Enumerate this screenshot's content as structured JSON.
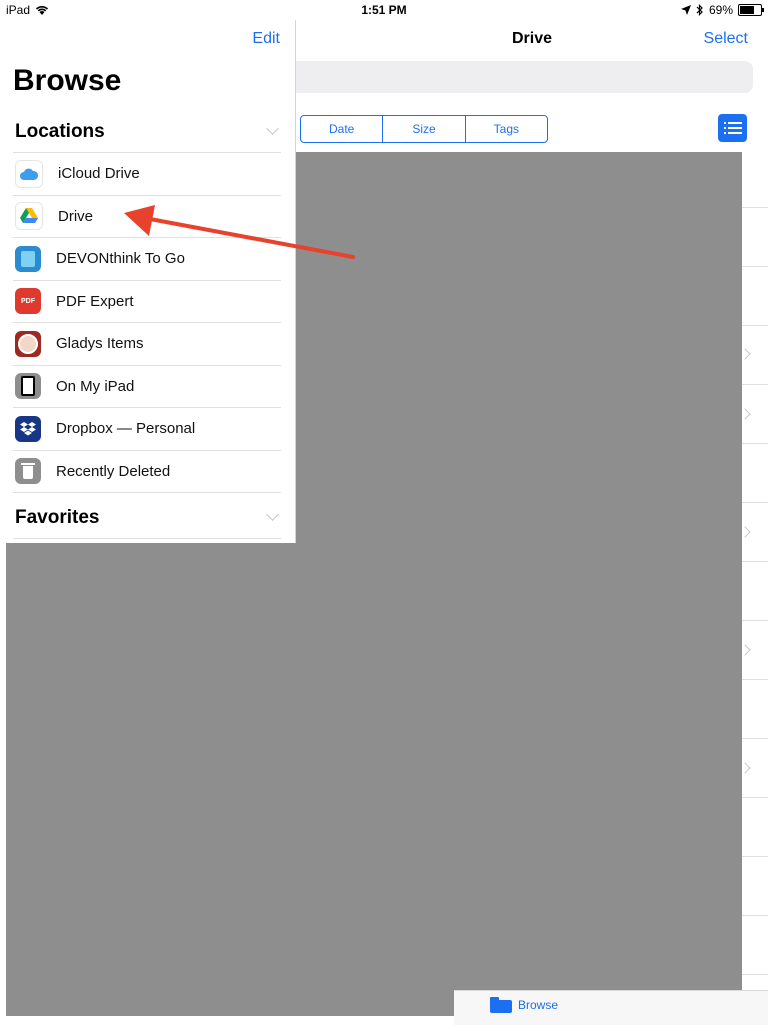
{
  "status_bar": {
    "device": "iPad",
    "time": "1:51 PM",
    "battery_percent": "69%",
    "battery_level": 0.69
  },
  "nav": {
    "edit_label": "Edit",
    "title": "Drive",
    "select_label": "Select"
  },
  "sort": {
    "options": [
      "Date",
      "Size",
      "Tags"
    ]
  },
  "sidebar": {
    "title": "Browse",
    "locations_header": "Locations",
    "favorites_header": "Favorites",
    "locations": [
      {
        "label": "iCloud Drive",
        "icon": "icloud-drive-icon"
      },
      {
        "label": "Drive",
        "icon": "google-drive-icon"
      },
      {
        "label": "DEVONthink To Go",
        "icon": "devonthink-icon"
      },
      {
        "label": "PDF Expert",
        "icon": "pdf-expert-icon"
      },
      {
        "label": "Gladys Items",
        "icon": "gladys-icon"
      },
      {
        "label": "On My iPad",
        "icon": "ipad-icon"
      },
      {
        "label": "Dropbox — Personal",
        "icon": "dropbox-icon"
      },
      {
        "label": "Recently Deleted",
        "icon": "trash-icon"
      }
    ]
  },
  "tab_bar": {
    "browse_label": "Browse"
  },
  "colors": {
    "accent": "#1d6ff2",
    "overlay": "#8e8e8e",
    "annotation_arrow": "#e8412c"
  }
}
